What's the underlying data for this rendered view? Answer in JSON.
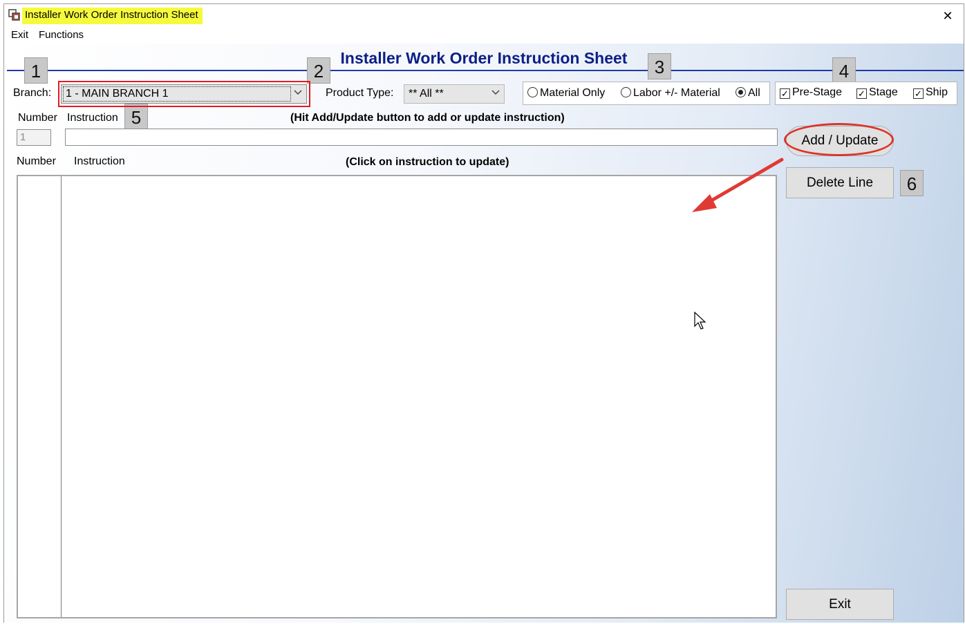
{
  "window": {
    "title": "Installer Work Order Instruction Sheet",
    "close_glyph": "✕"
  },
  "menu": {
    "items": [
      {
        "label": "Exit"
      },
      {
        "label": "Functions"
      }
    ]
  },
  "form": {
    "title": "Installer Work Order Instruction Sheet",
    "branch_label": "Branch:",
    "branch_value": "1  - MAIN BRANCH 1",
    "product_type_label": "Product Type:",
    "product_type_value": "** All **",
    "radios": [
      {
        "label": "Material Only",
        "selected": false
      },
      {
        "label": "Labor +/- Material",
        "selected": false
      },
      {
        "label": "All",
        "selected": true
      }
    ],
    "checkboxes": [
      {
        "label": "Pre-Stage",
        "checked": true
      },
      {
        "label": "Stage",
        "checked": true
      },
      {
        "label": "Ship",
        "checked": true
      }
    ],
    "entry_number_header": "Number",
    "entry_instruction_header": "Instruction",
    "entry_hint": "(Hit Add/Update button to add or update instruction)",
    "number_value": "1",
    "instruction_value": "",
    "list_number_header": "Number",
    "list_instruction_header": "Instruction",
    "list_hint": "(Click on instruction to update)",
    "add_update_label": "Add / Update",
    "delete_line_label": "Delete Line",
    "exit_label": "Exit"
  },
  "annotations": {
    "badges": [
      "1",
      "2",
      "3",
      "4",
      "5",
      "6"
    ],
    "highlight_color": "#e21b23",
    "arrow_color": "#e03a34"
  },
  "colors": {
    "title_highlight": "#f5fa3c",
    "form_title": "#0c1f87",
    "rule": "#1f3aa4"
  }
}
